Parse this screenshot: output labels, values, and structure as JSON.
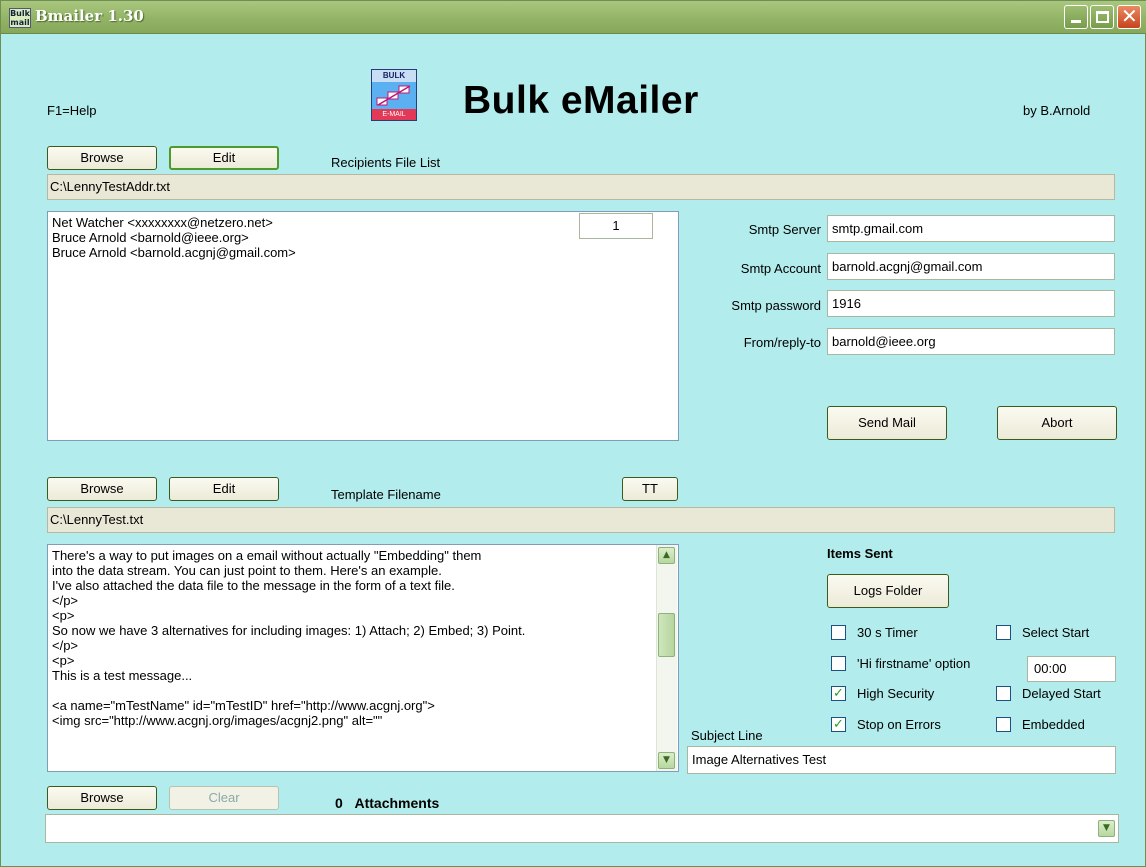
{
  "window": {
    "title": "Bmailer 1.30",
    "icon_text_line1": "Bulk",
    "icon_text_line2": "mail"
  },
  "header": {
    "help": "F1=Help",
    "app_name": "Bulk eMailer",
    "author": "by B.Arnold",
    "logo_text_top": "BULK",
    "logo_text_bottom": "E-MAIL"
  },
  "recipients": {
    "browse_label": "Browse",
    "edit_label": "Edit",
    "section_label": "Recipients File List",
    "file_path": "C:\\LennyTestAddr.txt",
    "counter": "1",
    "lines": [
      "Net Watcher <xxxxxxxx@netzero.net>",
      "Bruce Arnold <barnold@ieee.org>",
      "Bruce Arnold <barnold.acgnj@gmail.com>"
    ]
  },
  "smtp": {
    "server_label": "Smtp Server",
    "server_value": "smtp.gmail.com",
    "account_label": "Smtp Account",
    "account_value": "barnold.acgnj@gmail.com",
    "password_label": "Smtp password",
    "password_value": "1916",
    "from_label": "From/reply-to",
    "from_value": "barnold@ieee.org"
  },
  "actions": {
    "send_label": "Send Mail",
    "abort_label": "Abort"
  },
  "template": {
    "browse_label": "Browse",
    "edit_label": "Edit",
    "section_label": "Template Filename",
    "tt_label": "TT",
    "file_path": "C:\\LennyTest.txt",
    "lines": [
      "There's a way to put images on a email without actually \"Embedding\" them",
      "into the data stream.  You can just point to them. Here's an example.",
      "I've also attached the data file to the message in the form of a text file.",
      "</p>",
      "<p>",
      "So now we have 3 alternatives for including images: 1) Attach; 2) Embed; 3) Point.",
      "</p>",
      "<p>",
      "This is a test message...",
      "",
      "<a name=\"mTestName\" id=\"mTestID\" href=\"http://www.acgnj.org\">",
      "<img src=\"http://www.acgnj.org/images/acgnj2.png\" alt=\"\""
    ]
  },
  "options": {
    "items_sent_label": "Items Sent",
    "logs_folder_label": "Logs Folder",
    "timer_label": "30 s Timer",
    "hi_firstname_label": "'Hi firstname' option",
    "high_security_label": "High Security",
    "stop_on_errors_label": "Stop on Errors",
    "select_start_label": "Select Start",
    "time_value": "00:00",
    "delayed_start_label": "Delayed Start",
    "embedded_label": "Embedded",
    "timer_checked": false,
    "hi_firstname_checked": false,
    "high_security_checked": true,
    "stop_on_errors_checked": true,
    "select_start_checked": false,
    "delayed_start_checked": false,
    "embedded_checked": false
  },
  "subject": {
    "label": "Subject Line",
    "value": "Image Alternatives Test"
  },
  "attachments": {
    "browse_label": "Browse",
    "clear_label": "Clear",
    "count": "0",
    "label": "Attachments",
    "selected": ""
  },
  "colors": {
    "background": "#b3ecec",
    "titlebar": "#93b466",
    "check_mark": "#21a121"
  }
}
